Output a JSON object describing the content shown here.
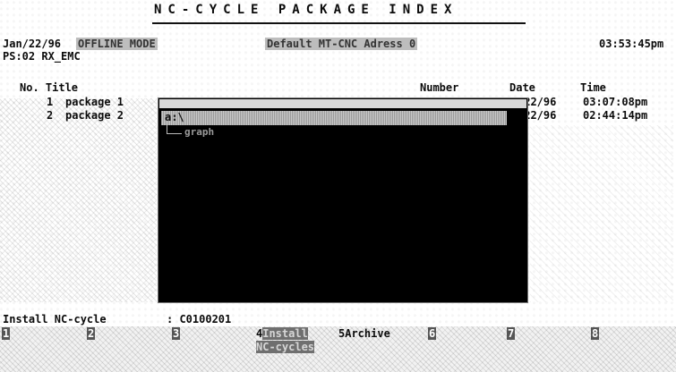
{
  "header": {
    "title": "NC-CYCLE PACKAGE INDEX",
    "date": "Jan/22/96",
    "mode": "OFFLINE MODE",
    "default_address": "Default MT-CNC Adress 0",
    "clock": "03:53:45pm",
    "ps_label": "PS:02 RX_EMC"
  },
  "table": {
    "columns": [
      "No. Title",
      "Number",
      "Date",
      "Time"
    ],
    "rows": [
      {
        "no": "1",
        "title": "package 1",
        "date": "/22/96",
        "time": "03:07:08pm"
      },
      {
        "no": "2",
        "title": "package 2",
        "date": "/22/96",
        "time": "02:44:14pm"
      }
    ]
  },
  "directory_popup": {
    "selected": "a:\\",
    "child": "graph"
  },
  "install": {
    "label": "Install NC-cycle",
    "value": ": C0100201"
  },
  "function_keys": [
    {
      "num": "1",
      "label": ""
    },
    {
      "num": "2",
      "label": ""
    },
    {
      "num": "3",
      "label": ""
    },
    {
      "num": "4",
      "label": "Install NC-cycles"
    },
    {
      "num": "5",
      "label": "Archive"
    },
    {
      "num": "6",
      "label": ""
    },
    {
      "num": "7",
      "label": ""
    },
    {
      "num": "8",
      "label": ""
    }
  ]
}
